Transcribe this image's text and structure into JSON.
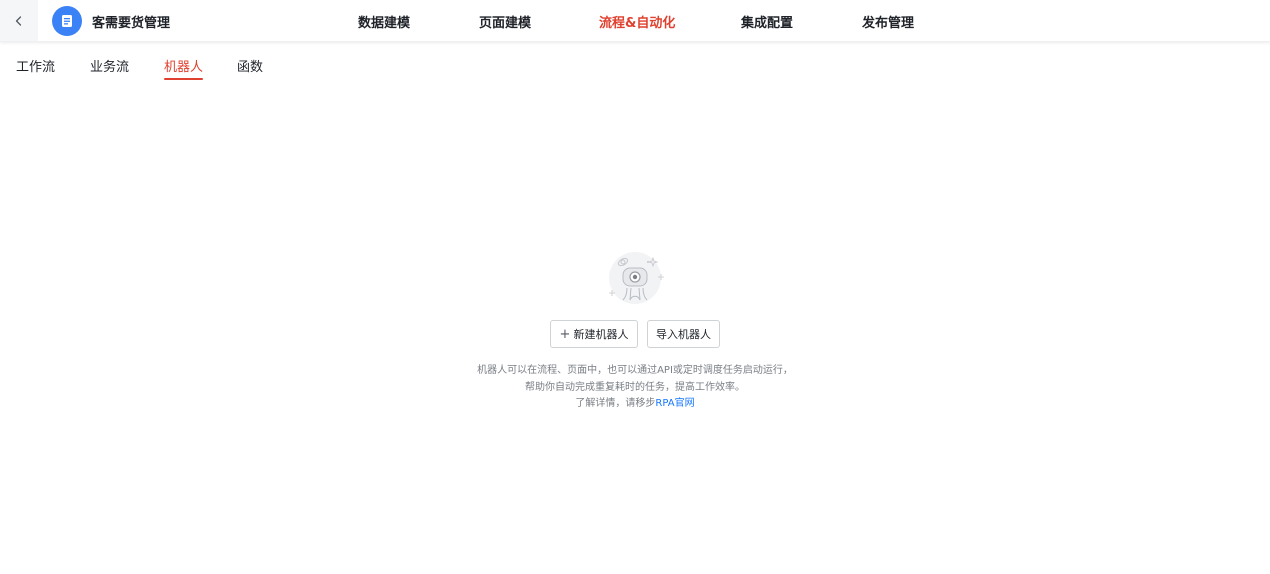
{
  "header": {
    "app_title": "客需要货管理",
    "nav": [
      {
        "label": "数据建模"
      },
      {
        "label": "页面建模"
      },
      {
        "label": "流程&自动化"
      },
      {
        "label": "集成配置"
      },
      {
        "label": "发布管理"
      }
    ],
    "active_nav": "流程&自动化"
  },
  "sub_tabs": [
    {
      "label": "工作流"
    },
    {
      "label": "业务流"
    },
    {
      "label": "机器人"
    },
    {
      "label": "函数"
    }
  ],
  "active_sub_tab": "机器人",
  "empty_state": {
    "new_button": "新建机器人",
    "import_button": "导入机器人",
    "line1": "机器人可以在流程、页面中，也可以通过API或定时调度任务启动运行，",
    "line2": "帮助你自动完成重复耗时的任务，提高工作效率。",
    "line3_prefix": "了解详情，请移步",
    "line3_link": "RPA官网"
  },
  "colors": {
    "accent": "#e0402f",
    "link": "#1677ff",
    "logo": "#3b82f6"
  },
  "icons": {
    "back": "chevron-left-icon",
    "logo": "document-icon",
    "plus": "plus-icon",
    "illustration": "robot-illustration"
  }
}
